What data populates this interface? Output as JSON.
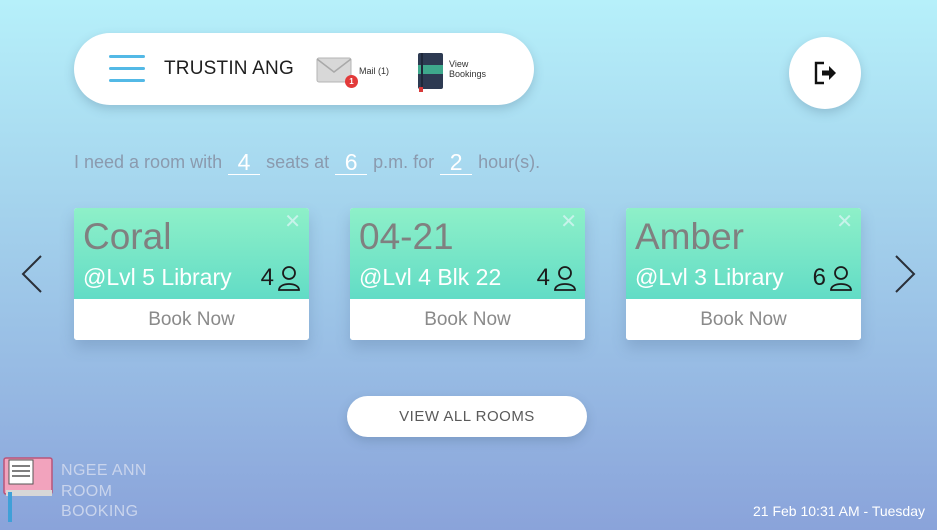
{
  "header": {
    "username": "TRUSTIN ANG",
    "mail": {
      "label": "Mail (1)",
      "badge": "1"
    },
    "bookings": {
      "label_line1": "View",
      "label_line2": "Bookings"
    }
  },
  "query": {
    "part1": "I need a room with",
    "seats": "4",
    "part2": "seats at",
    "time": "6",
    "part3": "p.m. for",
    "hours": "2",
    "part4": "hour(s)."
  },
  "rooms": [
    {
      "name": "Coral",
      "location": "@Lvl 5 Library",
      "seats": "4",
      "action": "Book Now"
    },
    {
      "name": "04-21",
      "location": "@Lvl 4 Blk 22",
      "seats": "4",
      "action": "Book Now"
    },
    {
      "name": "Amber",
      "location": "@Lvl 3 Library",
      "seats": "6",
      "action": "Book Now"
    }
  ],
  "view_all_label": "VIEW ALL ROOMS",
  "brand": {
    "line1": "NGEE ANN",
    "line2": "ROOM",
    "line3": "BOOKING"
  },
  "datetime": "21 Feb 10:31 AM - Tuesday",
  "colors": {
    "accent": "#53b9e6",
    "card_gradient_top": "#8ef0c8",
    "card_gradient_bottom": "#62dcc6",
    "badge": "#e23a3a"
  },
  "icons": [
    "hamburger-icon",
    "mail-icon",
    "bookings-book-icon",
    "logout-icon",
    "close-icon",
    "person-icon",
    "chevron-left-icon",
    "chevron-right-icon",
    "app-logo-icon"
  ]
}
